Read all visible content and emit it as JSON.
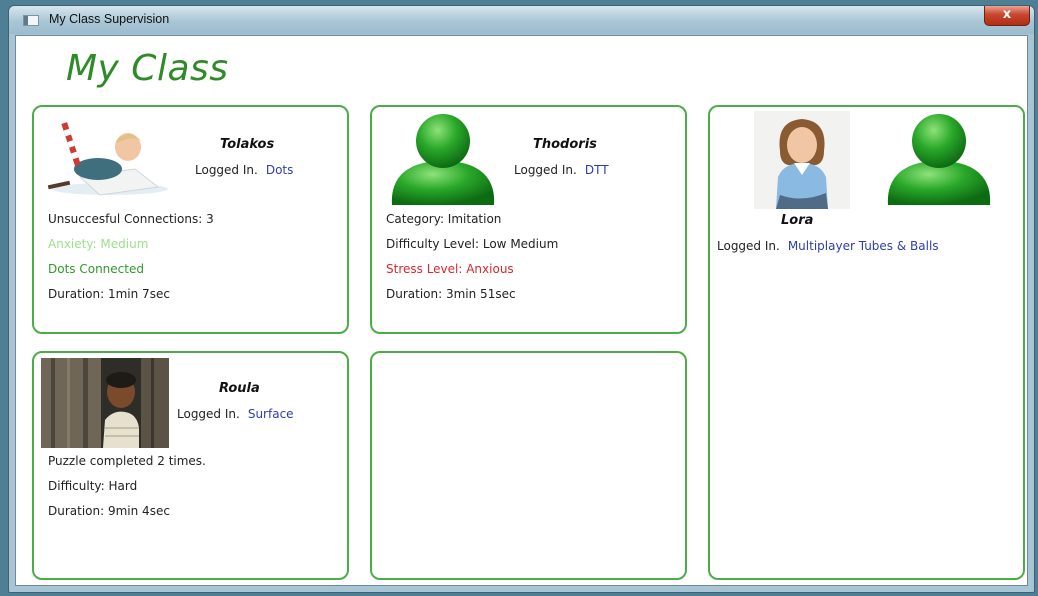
{
  "window": {
    "title": "My Class Supervision",
    "close_label": "x"
  },
  "app_title": "My Class",
  "students": {
    "tolakos": {
      "name": "Tolakos",
      "status": "Logged In.",
      "activity": "Dots",
      "details": [
        {
          "text": "Unsuccesful Connections: 3",
          "color": "#222222"
        },
        {
          "text": "Anxiety: Medium",
          "color": "#9be08a"
        },
        {
          "text": "Dots Connected",
          "color": "#2f9a2b"
        },
        {
          "text": "Duration: 1min 7sec",
          "color": "#222222"
        }
      ]
    },
    "thodoris": {
      "name": "Thodoris",
      "status": "Logged In.",
      "activity": "DTT",
      "details": [
        {
          "text": "Category: Imitation",
          "color": "#222222"
        },
        {
          "text": "Difficulty Level: Low Medium",
          "color": "#222222"
        },
        {
          "text": "Stress Level: Anxious",
          "color": "#d8292c"
        },
        {
          "text": "Duration: 3min 51sec",
          "color": "#222222"
        }
      ]
    },
    "lora": {
      "name": "Lora",
      "status": "Logged In.",
      "activity": "Multiplayer Tubes & Balls"
    },
    "roula": {
      "name": "Roula",
      "status": "Logged In.",
      "activity": "Surface",
      "details": [
        {
          "text": "Puzzle completed 2 times.",
          "color": "#222222"
        },
        {
          "text": "Difficulty: Hard",
          "color": "#222222"
        },
        {
          "text": "Duration: 9min 4sec",
          "color": "#222222"
        }
      ]
    }
  },
  "colors": {
    "accent_green": "#2e8b27",
    "card_border": "#4cac48",
    "activity_blue": "#2d3fa8"
  },
  "icons": [
    "user-avatar-icon",
    "app-window-icon",
    "close-icon"
  ]
}
